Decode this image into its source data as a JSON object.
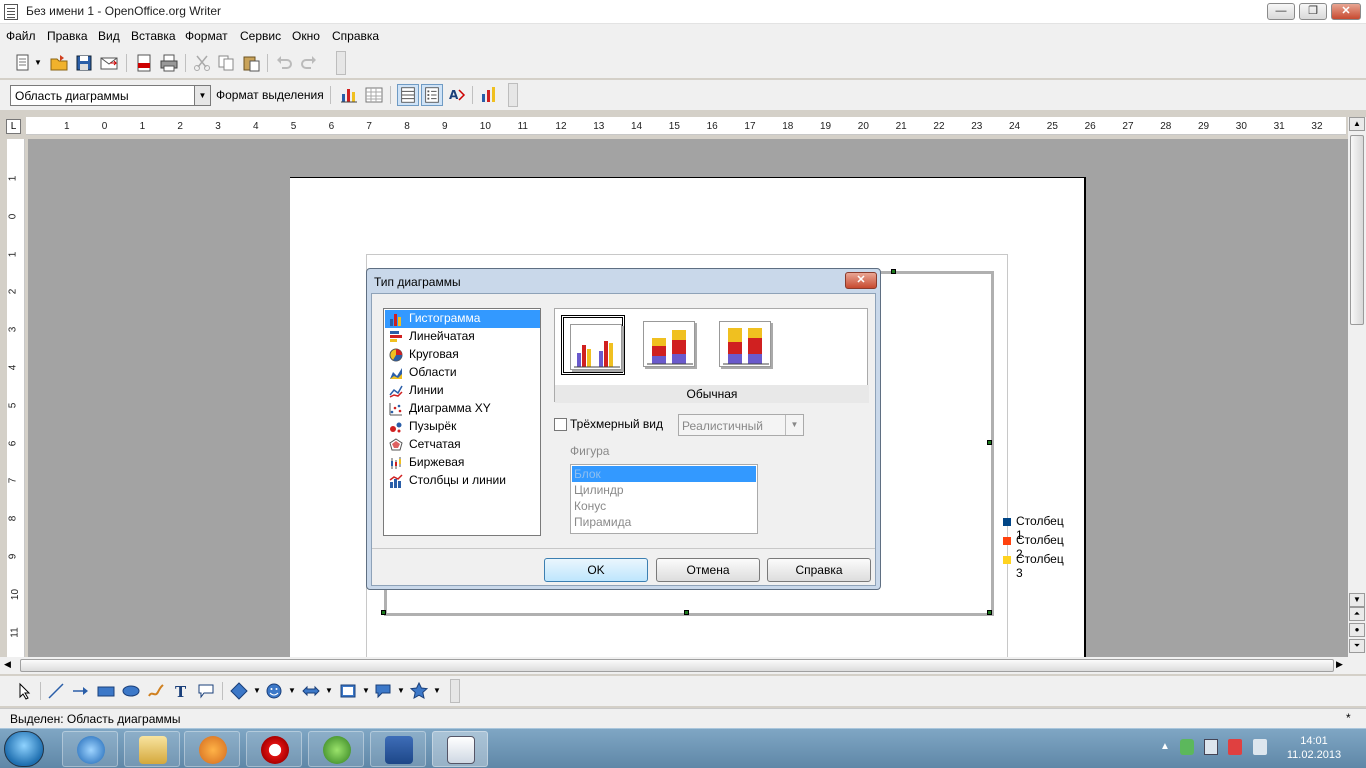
{
  "window": {
    "title": "Без имени 1 - OpenOffice.org Writer"
  },
  "menu": [
    "Файл",
    "Правка",
    "Вид",
    "Вставка",
    "Формат",
    "Сервис",
    "Окно",
    "Справка"
  ],
  "format_toolbar": {
    "object_combo": "Область диаграммы",
    "format_selection_label": "Формат выделения"
  },
  "ruler": {
    "corner": "L",
    "h_ticks": [
      "1",
      "0",
      "1",
      "2",
      "3",
      "4",
      "5",
      "6",
      "7",
      "8",
      "9",
      "10",
      "11",
      "12",
      "13",
      "14",
      "15",
      "16",
      "17",
      "18",
      "19",
      "20",
      "21",
      "22",
      "23",
      "24",
      "25",
      "26",
      "27",
      "28",
      "29",
      "30",
      "31",
      "32"
    ],
    "v_ticks": [
      "1",
      "0",
      "1",
      "2",
      "3",
      "4",
      "5",
      "6",
      "7",
      "8",
      "9",
      "10",
      "11"
    ]
  },
  "chart": {
    "legend": [
      {
        "label": "Столбец 1",
        "color": "#004586"
      },
      {
        "label": "Столбец 2",
        "color": "#ff420e"
      },
      {
        "label": "Столбец 3",
        "color": "#ffd320"
      }
    ]
  },
  "dialog": {
    "title": "Тип диаграммы",
    "close_glyph": "✕",
    "chart_types": [
      {
        "label": "Гистограмма",
        "icon": "column-chart-icon",
        "selected": true
      },
      {
        "label": "Линейчатая",
        "icon": "bar-chart-icon"
      },
      {
        "label": "Круговая",
        "icon": "pie-chart-icon"
      },
      {
        "label": "Области",
        "icon": "area-chart-icon"
      },
      {
        "label": "Линии",
        "icon": "line-chart-icon"
      },
      {
        "label": "Диаграмма XY",
        "icon": "xy-chart-icon"
      },
      {
        "label": "Пузырёк",
        "icon": "bubble-chart-icon"
      },
      {
        "label": "Сетчатая",
        "icon": "net-chart-icon"
      },
      {
        "label": "Биржевая",
        "icon": "stock-chart-icon"
      },
      {
        "label": "Столбцы и линии",
        "icon": "column-line-chart-icon"
      }
    ],
    "variant_name": "Обычная",
    "three_d_label": "Трёхмерный вид",
    "three_d_checked": false,
    "three_d_style": "Реалистичный",
    "shape_label": "Фигура",
    "shapes": [
      "Блок",
      "Цилиндр",
      "Конус",
      "Пирамида"
    ],
    "selected_shape": "Блок",
    "buttons": {
      "ok": "OK",
      "cancel": "Отмена",
      "help": "Справка"
    }
  },
  "statusbar": {
    "text": "Выделен: Область диаграммы"
  },
  "taskbar": {
    "time": "14:01",
    "date": "11.02.2013"
  }
}
